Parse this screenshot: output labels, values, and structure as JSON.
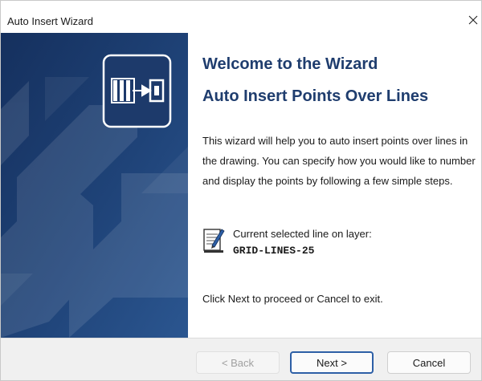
{
  "window": {
    "title": "Auto Insert Wizard",
    "close_glyph": "×"
  },
  "content": {
    "heading_line1": "Welcome to the Wizard",
    "heading_line2": "Auto Insert Points Over Lines",
    "description": "This wizard will help you to auto insert points over lines in the drawing. You can specify how you would like to number and display the points by following a few simple steps.",
    "layer_label": "Current selected line on layer:",
    "layer_value": "GRID-LINES-25",
    "footer": "Click Next to proceed or Cancel to exit."
  },
  "buttons": {
    "back_label": "< Back",
    "next_label": "Next >",
    "cancel_label": "Cancel"
  },
  "icons": {
    "sidebar_logo": "wizard-logo-icon",
    "layer": "notepad-pencil-icon",
    "close": "close-icon"
  },
  "colors": {
    "sidebar_bg": "#1c3a6a",
    "heading": "#1f3d6e",
    "default_button_border": "#2d5fa6",
    "button_bar": "#f0f0f0"
  }
}
